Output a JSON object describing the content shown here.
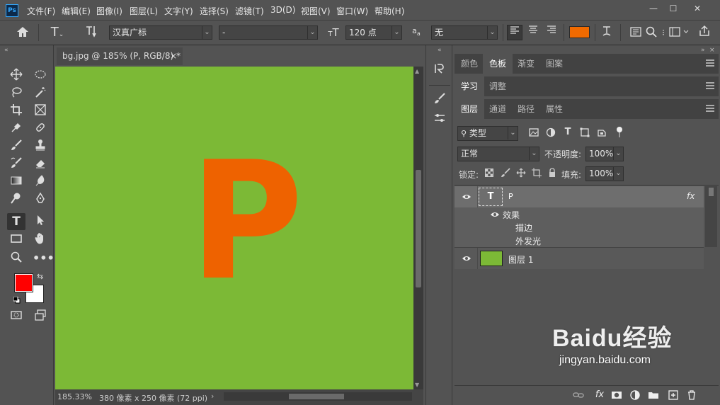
{
  "app": {
    "logo": "Ps"
  },
  "menubar": {
    "items": [
      "文件(F)",
      "编辑(E)",
      "图像(I)",
      "图层(L)",
      "文字(Y)",
      "选择(S)",
      "滤镜(T)",
      "3D(D)",
      "视图(V)",
      "窗口(W)",
      "帮助(H)"
    ]
  },
  "window_controls": {
    "minimize": "—",
    "maximize": "☐",
    "close": "✕"
  },
  "options": {
    "font_family": "汉真广标",
    "font_style": "-",
    "font_size": "120 点",
    "aa_label": "a",
    "anti_alias": "无",
    "text_color": "#f06a00"
  },
  "document": {
    "tab_title": "bg.jpg @ 185% (P, RGB/8) *",
    "close": "×",
    "canvas_color": "#7cb936",
    "letter": "P",
    "letter_color": "#ee6200"
  },
  "status": {
    "zoom": "185.33%",
    "info": "380 像素 x 250 像素 (72 ppi)",
    "arrow": "›"
  },
  "colors": {
    "foreground": "#ff0000",
    "background": "#ffffff"
  },
  "panels": {
    "group1_tabs": [
      "颜色",
      "色板",
      "渐变",
      "图案"
    ],
    "group2_tabs": [
      "学习",
      "调整"
    ],
    "group3_tabs": [
      "图层",
      "通道",
      "路径",
      "属性"
    ],
    "filter_label": "类型",
    "blend_mode": "正常",
    "opacity_label": "不透明度:",
    "opacity_value": "100%",
    "lock_label": "锁定:",
    "fill_label": "填充:",
    "fill_value": "100%",
    "layers": [
      {
        "name": "P",
        "type": "text",
        "thumb": "T",
        "fx": "fx"
      },
      {
        "name": "效果",
        "type": "effects-header"
      },
      {
        "name": "描边",
        "type": "effect"
      },
      {
        "name": "外发光",
        "type": "effect"
      },
      {
        "name": "图层 1",
        "type": "fill",
        "thumb_color": "#7cb936"
      }
    ],
    "bottom_fx": "fx"
  },
  "watermark": {
    "brand": "Baidu经验",
    "url": "jingyan.baidu.com"
  }
}
